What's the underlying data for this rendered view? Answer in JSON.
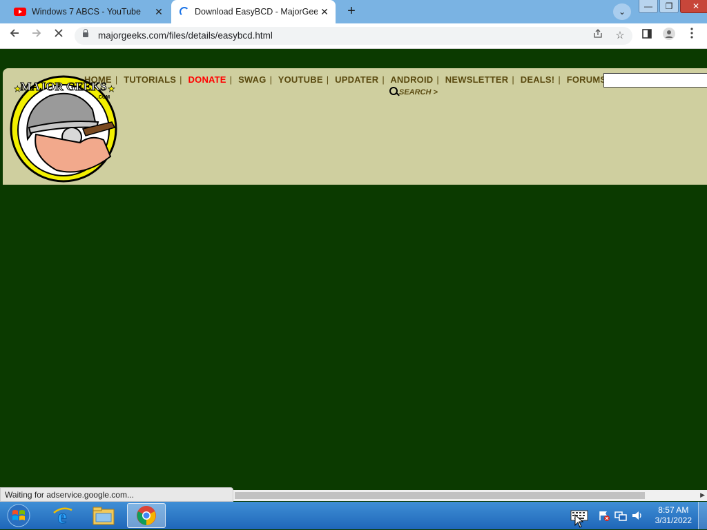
{
  "browser": {
    "tabs": [
      {
        "title": "Windows 7 ABCS - YouTube",
        "close": "✕",
        "favicon": "youtube-icon"
      },
      {
        "title": "Download EasyBCD - MajorGeeks",
        "close": "✕",
        "favicon": "loading-icon"
      }
    ],
    "new_tab": "+",
    "tab_search": "⌄",
    "window_controls": {
      "minimize": "—",
      "restore": "❐",
      "close": "✕"
    },
    "url": "majorgeeks.com/files/details/easybcd.html",
    "status": "Waiting for adservice.google.com..."
  },
  "site": {
    "logo_text": "MAJOR GEEKS",
    "logo_sub": ".COM",
    "nav": [
      {
        "label": "HOME"
      },
      {
        "label": "TUTORIALS"
      },
      {
        "label": "DONATE"
      },
      {
        "label": "SWAG"
      },
      {
        "label": "YOUTUBE"
      },
      {
        "label": "UPDATER"
      },
      {
        "label": "ANDROID"
      },
      {
        "label": "NEWSLETTER"
      },
      {
        "label": "DEALS!"
      },
      {
        "label": "FORUMS"
      }
    ],
    "separator": "|",
    "search_link": "SEARCH >",
    "search_value": ""
  },
  "taskbar": {
    "time": "8:57 AM",
    "date": "3/31/2022"
  },
  "colors": {
    "page_bg": "#0b3a00",
    "banner_bg": "#cfcf9f",
    "nav_text": "#5a4a10",
    "donate": "#ff0000"
  }
}
